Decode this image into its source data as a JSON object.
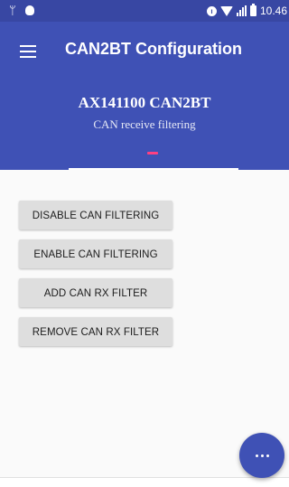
{
  "status_bar": {
    "time": "10.46",
    "icons": [
      "usb-icon",
      "bug-icon",
      "circle-icon",
      "wifi-icon",
      "signal-icon",
      "battery-icon"
    ]
  },
  "toolbar": {
    "title": "CAN2BT Configuration",
    "menu_icon": "menu-icon"
  },
  "header": {
    "title": "AX141100 CAN2BT",
    "subtitle": "CAN receive filtering"
  },
  "buttons": {
    "disable": "DISABLE CAN FILTERING",
    "enable": "ENABLE CAN FILTERING",
    "add": "ADD CAN RX FILTER",
    "remove": "REMOVE CAN RX FILTER"
  },
  "fab": {
    "icon": "more-horiz-icon"
  },
  "colors": {
    "primary": "#3f51b5",
    "primary_dark": "#3847a3",
    "accent": "#ff4081",
    "button_bg": "#dedede"
  }
}
